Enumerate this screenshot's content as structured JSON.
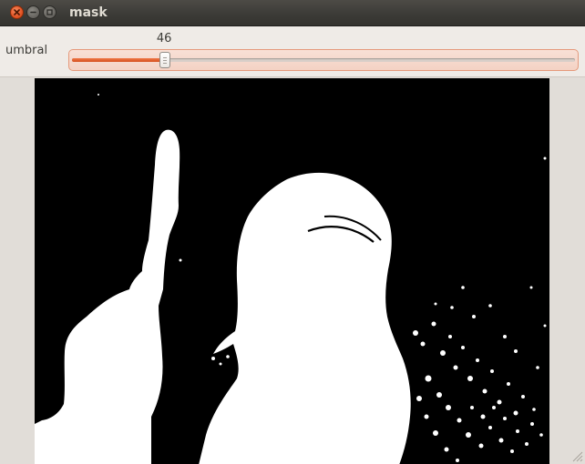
{
  "window": {
    "title": "mask",
    "close_icon": "close-icon",
    "minimize_icon": "minimize-icon",
    "maximize_icon": "maximize-icon"
  },
  "trackbar": {
    "label": "umbral",
    "value": "46",
    "fraction": 0.185,
    "accent": "#e05a25"
  },
  "image": {
    "content": "binary-threshold-mask",
    "foreground_color": "#ffffff",
    "background_color": "#000000"
  }
}
